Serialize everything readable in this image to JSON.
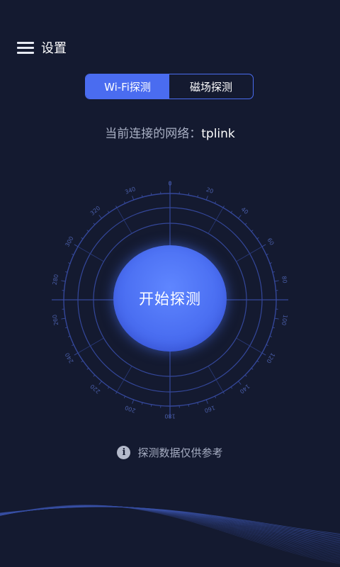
{
  "header": {
    "title": "设置"
  },
  "tabs": [
    {
      "label": "Wi-Fi探测",
      "active": true
    },
    {
      "label": "磁场探测",
      "active": false
    }
  ],
  "network": {
    "label": "当前连接的网络：",
    "ssid": "tplink"
  },
  "compass": {
    "degree_labels": [
      "0",
      "20",
      "40",
      "60",
      "80",
      "100",
      "120",
      "140",
      "160",
      "180",
      "200",
      "220",
      "240",
      "260",
      "280",
      "300",
      "320",
      "340"
    ]
  },
  "start_button": {
    "label": "开始探测"
  },
  "disclaimer": {
    "icon": "info-icon",
    "text": "探测数据仅供参考"
  },
  "colors": {
    "background": "#141a30",
    "accent": "#4a6cf0",
    "ring": "#3a4fa0"
  }
}
